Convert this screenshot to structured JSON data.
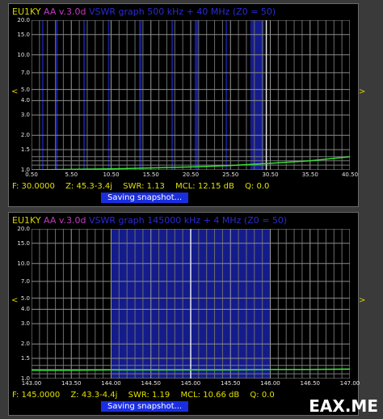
{
  "watermark": "EAX.ME",
  "arrows": {
    "left": "<",
    "right": ">"
  },
  "screens": [
    {
      "title": {
        "device": "EU1KY",
        "version": "AA v.3.0d",
        "mode": "VSWR graph  500 kHz + 40 MHz   (Z0 = 50)"
      },
      "status": {
        "freq": "F: 30.0000",
        "impedance": "Z: 45.3-3.4j",
        "swr": "SWR: 1.13",
        "mcl": "MCL: 12.15 dB",
        "q": "Q: 0.0"
      },
      "saving": "Saving snapshot...",
      "chart_data": {
        "type": "line",
        "y_ticks": [
          "20.0",
          "15.0",
          "10.0",
          "7.0",
          "5.0",
          "4.0",
          "3.0",
          "2.0",
          "1.5",
          "1.0"
        ],
        "x_ticks": [
          "0.50",
          "5.50",
          "10.50",
          "15.50",
          "20.50",
          "25.50",
          "30.50",
          "35.50",
          "40.50"
        ],
        "x_range": [
          0.5,
          40.5
        ],
        "y_range": [
          1.0,
          20.0
        ],
        "cursor_x": 30.0,
        "bands": [
          [
            1.8,
            2.0
          ],
          [
            3.5,
            3.8
          ],
          [
            7.0,
            7.2
          ],
          [
            10.1,
            10.15
          ],
          [
            14.0,
            14.35
          ],
          [
            18.07,
            18.17
          ],
          [
            21.0,
            21.45
          ],
          [
            24.89,
            24.99
          ],
          [
            28.0,
            29.7
          ]
        ],
        "series": [
          {
            "x": [
              0.5,
              5.5,
              10.5,
              15.5,
              20.5,
              25.5,
              30.5,
              35.5,
              40.5
            ],
            "y": [
              1.0,
              1.01,
              1.02,
              1.04,
              1.06,
              1.09,
              1.14,
              1.2,
              1.3
            ]
          }
        ]
      }
    },
    {
      "title": {
        "device": "EU1KY",
        "version": "AA v.3.0d",
        "mode": "VSWR graph  145000 kHz + 4 MHz   (Z0 = 50)"
      },
      "status": {
        "freq": "F: 145.0000",
        "impedance": "Z: 43.3-4.4j",
        "swr": "SWR: 1.19",
        "mcl": "MCL: 10.66 dB",
        "q": "Q: 0.0"
      },
      "saving": "Saving snapshot...",
      "chart_data": {
        "type": "line",
        "y_ticks": [
          "20.0",
          "15.0",
          "10.0",
          "7.0",
          "5.0",
          "4.0",
          "3.0",
          "2.0",
          "1.5",
          "1.0"
        ],
        "x_ticks": [
          "143.00",
          "143.50",
          "144.00",
          "144.50",
          "145.00",
          "145.50",
          "146.00",
          "146.50",
          "147.00"
        ],
        "x_range": [
          143.0,
          147.0
        ],
        "y_range": [
          1.0,
          20.0
        ],
        "cursor_x": 145.0,
        "bands": [
          [
            144.0,
            146.0
          ]
        ],
        "series": [
          {
            "x": [
              143.0,
              143.5,
              144.0,
              144.5,
              145.0,
              145.5,
              146.0,
              146.5,
              147.0
            ],
            "y": [
              1.18,
              1.18,
              1.19,
              1.19,
              1.19,
              1.19,
              1.2,
              1.2,
              1.21
            ]
          }
        ]
      }
    }
  ]
}
